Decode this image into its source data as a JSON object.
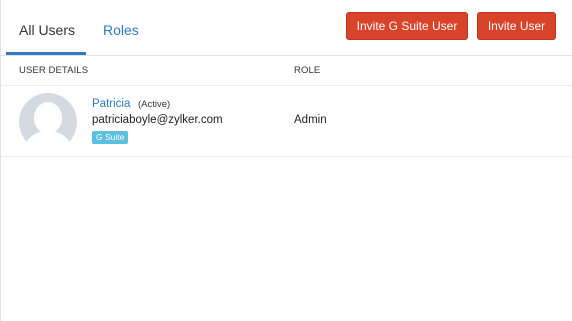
{
  "tabs": {
    "all_users": "All Users",
    "roles": "Roles"
  },
  "actions": {
    "invite_gsuite": "Invite G Suite User",
    "invite_user": "Invite User"
  },
  "columns": {
    "user_details": "USER DETAILS",
    "role": "ROLE"
  },
  "users": [
    {
      "name": "Patricia",
      "status": "(Active)",
      "email": "patriciaboyle@zylker.com",
      "badge": "G Suite",
      "role": "Admin"
    }
  ],
  "colors": {
    "accent": "#2e7bc4",
    "button": "#d8432a",
    "badge": "#5bc0de"
  }
}
